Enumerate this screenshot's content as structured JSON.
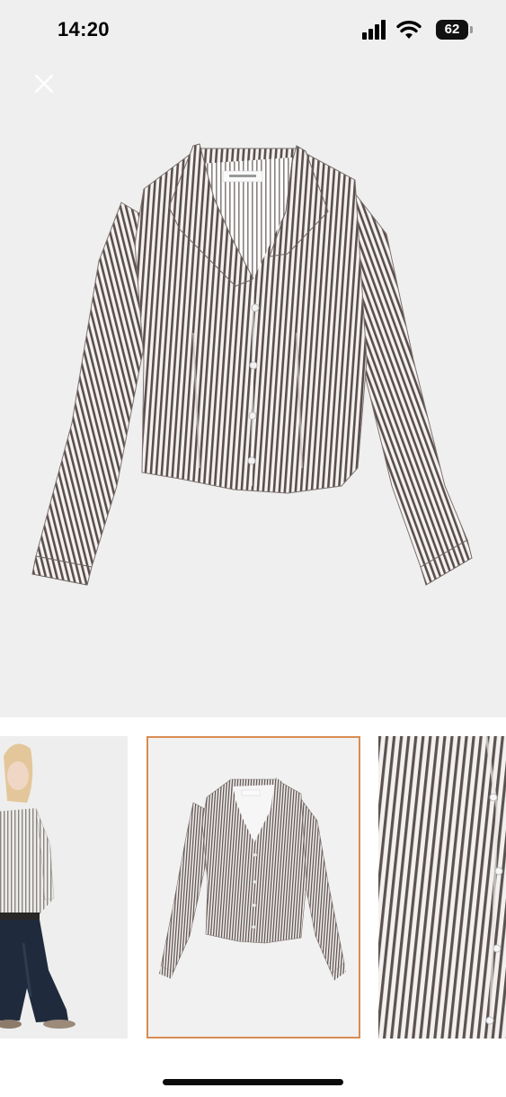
{
  "status_bar": {
    "time": "14:20",
    "battery_level": "62",
    "icons": [
      "signal-icon",
      "wifi-icon",
      "battery-icon"
    ]
  },
  "viewer": {
    "close_icon": "close-icon",
    "selected_index": 1
  },
  "thumbnails": [
    {
      "name": "model-wearing-shirt",
      "selected": false
    },
    {
      "name": "shirt-front-view",
      "selected": true
    },
    {
      "name": "fabric-detail",
      "selected": false
    }
  ],
  "colors": {
    "background": "#efefef",
    "selected_border": "#d98c52",
    "stripe_dark": "#5a4f4d",
    "stripe_light": "#f4f2f1"
  }
}
